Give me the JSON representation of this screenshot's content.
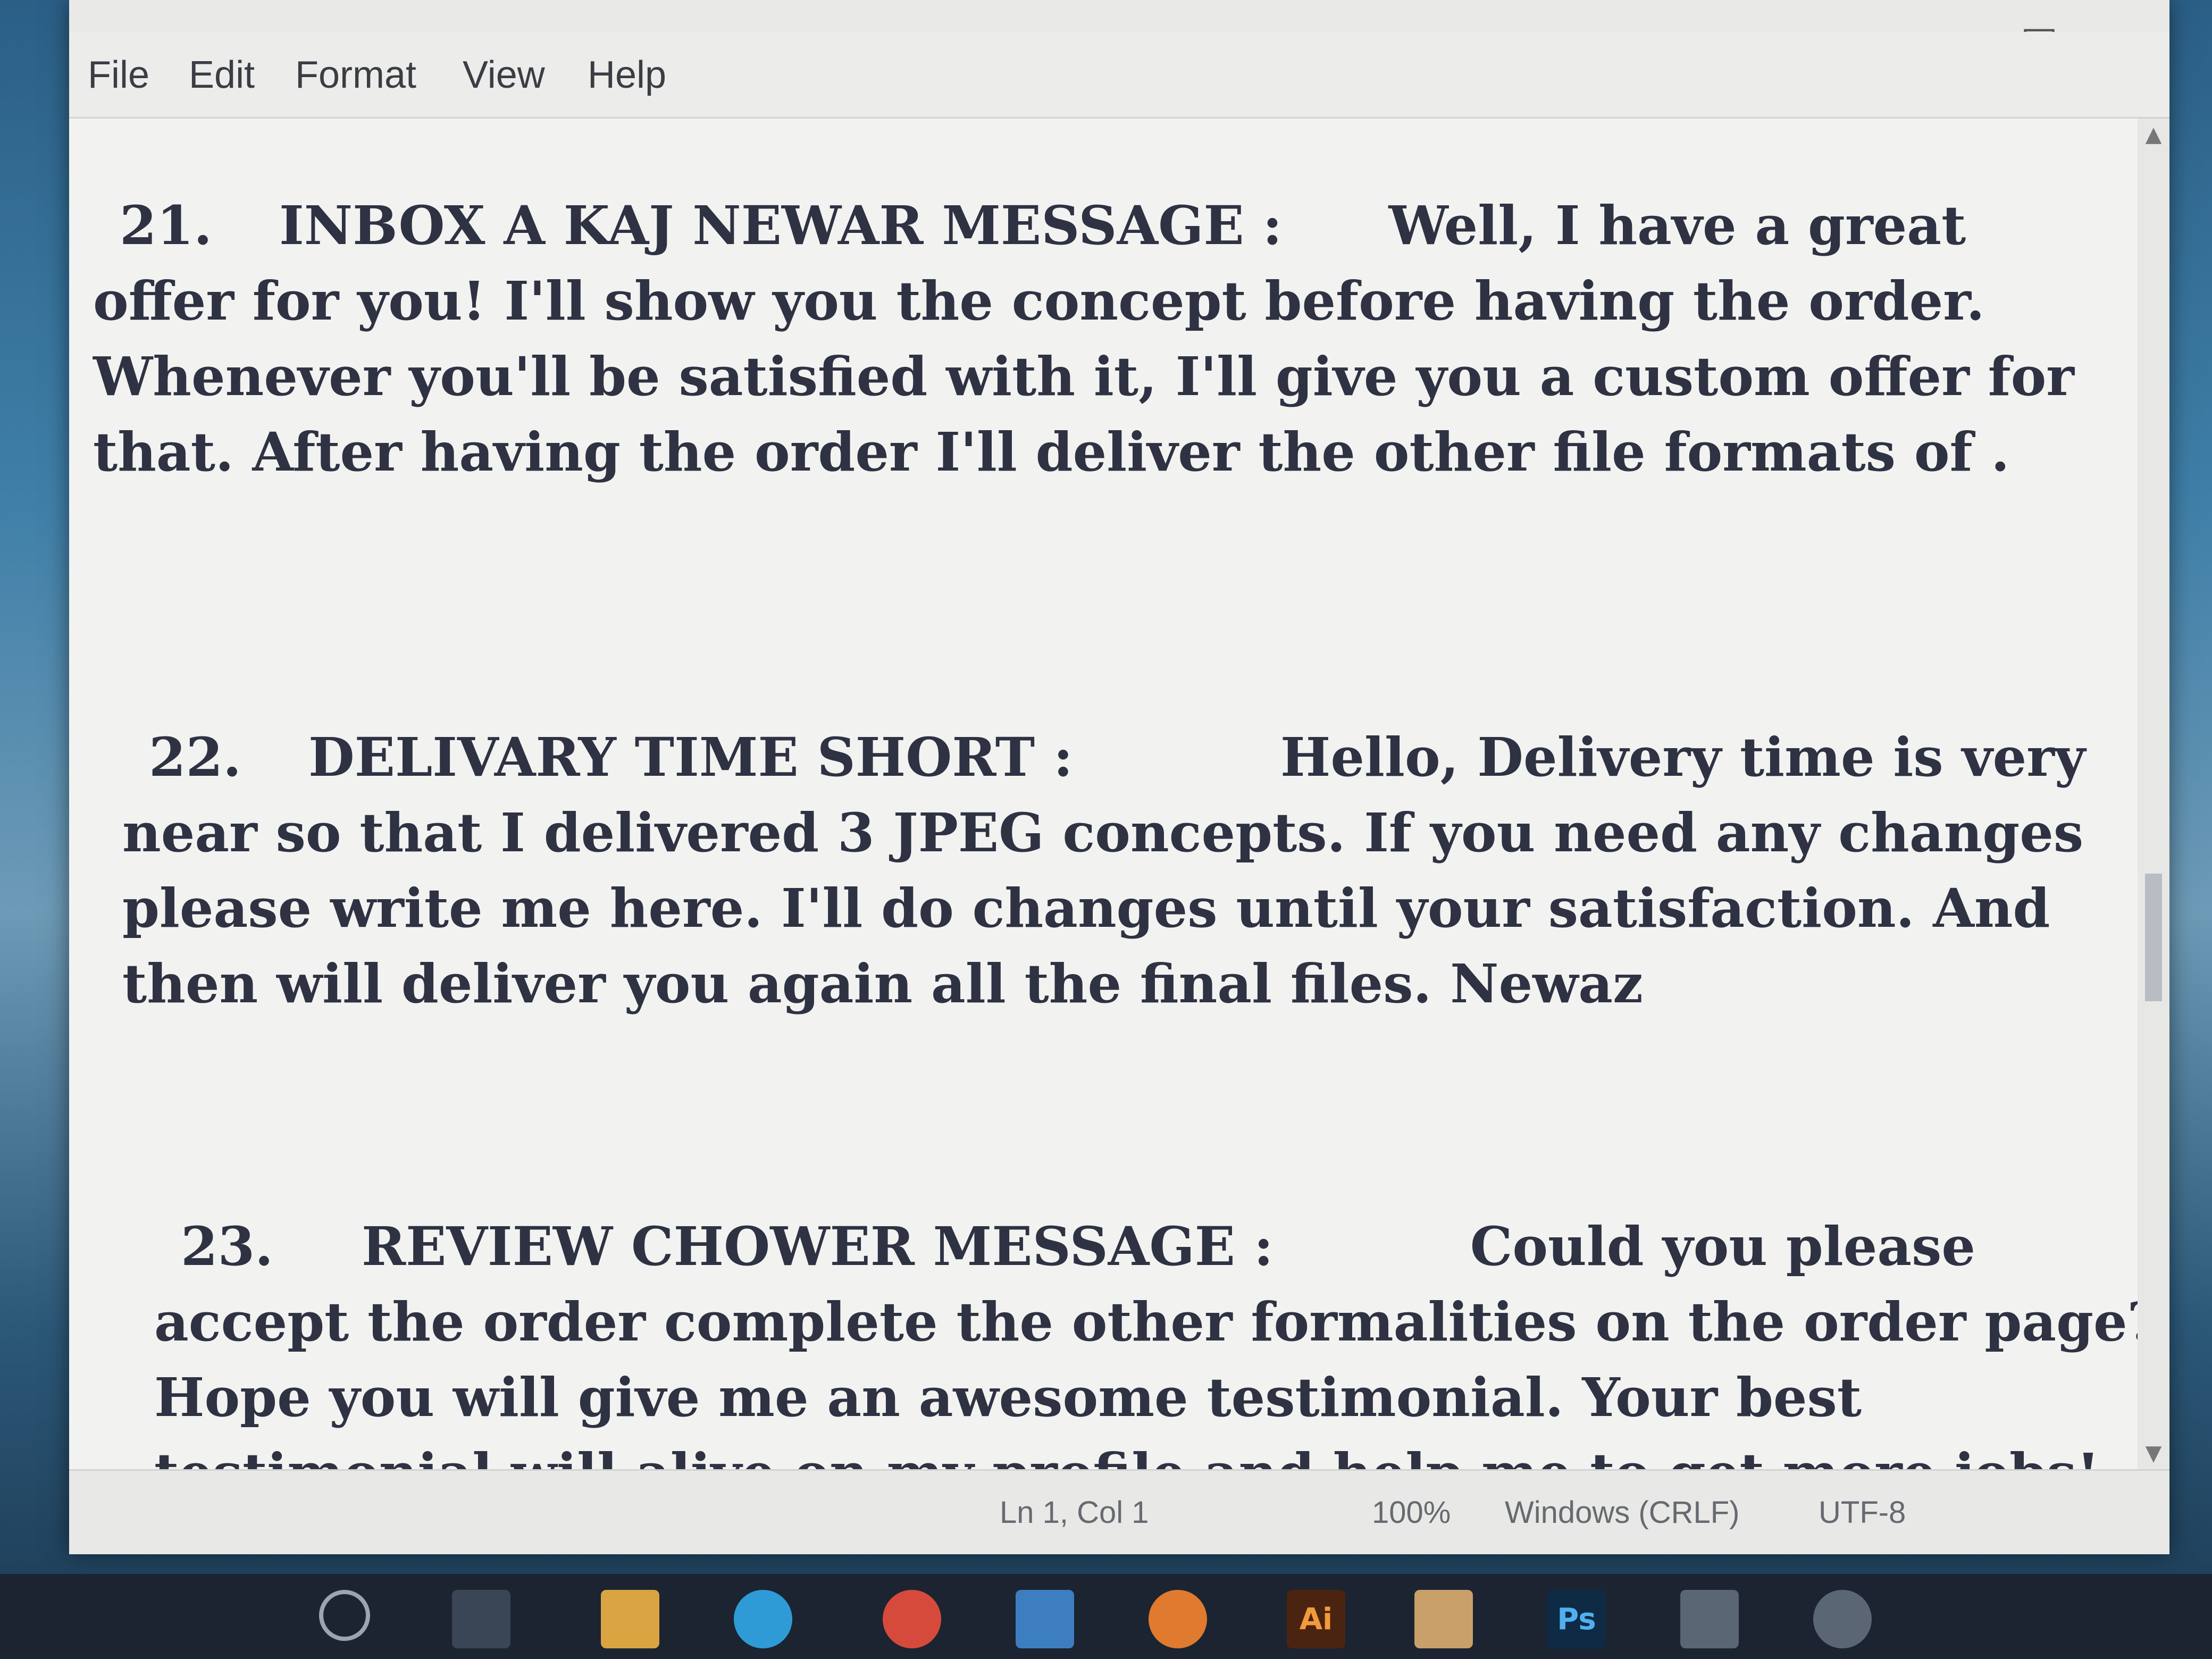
{
  "menu": {
    "file": "File",
    "edit": "Edit",
    "format": "Format",
    "view": "View",
    "help": "Help"
  },
  "window_controls": {
    "minimize": "—",
    "maximize": "☐",
    "close": "✕"
  },
  "document": {
    "paragraphs": [
      {
        "number": "21.",
        "heading": "INBOX A KAJ NEWAR MESSAGE :",
        "body": "Well, I have a great offer for you! I'll show you the concept before having the order. Whenever you'll be satisfied with it, I'll give you a custom offer for that. After having the order I'll deliver the other file formats of ."
      },
      {
        "number": "22.",
        "heading": "DELIVARY TIME SHORT :",
        "body": "Hello, Delivery time is very near so that I delivered 3 JPEG concepts. If you need any changes please write me here. I'll do changes until your satisfaction. And then will deliver you again all the final files. Newaz"
      },
      {
        "number": "23.",
        "heading": "REVIEW CHOWER MESSAGE :",
        "body": "Could you please accept the order complete the other formalities on the order page? Hope you will give me an awesome testimonial. Your best testimonial will alive on my profile and help me to get more jobs!"
      }
    ]
  },
  "status": {
    "position": "Ln 1, Col 1",
    "zoom": "100%",
    "line_ending": "Windows (CRLF)",
    "encoding": "UTF-8"
  },
  "taskbar": {
    "ai_label": "Ai",
    "ps_label": "Ps"
  },
  "colors": {
    "document_bg": "#f2f3f1",
    "text": "#2e3242",
    "menubar_bg": "#ecedea"
  }
}
